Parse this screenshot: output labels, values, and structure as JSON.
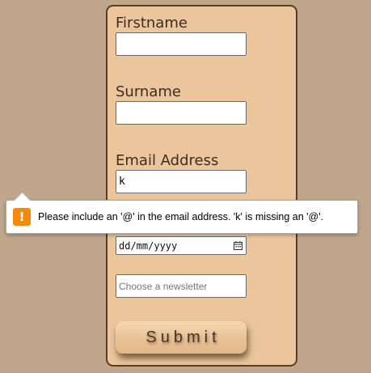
{
  "form": {
    "firstname_label": "Firstname",
    "firstname_value": "",
    "surname_label": "Surname",
    "surname_value": "",
    "email_label": "Email Address",
    "email_value": "k",
    "date_value": "dd/mm/yyyy",
    "newsletter_placeholder": "Choose a newsletter",
    "submit_label": "Submit"
  },
  "validation_tooltip": {
    "icon": "warning-icon",
    "message": "Please include an '@' in the email address. 'k' is missing an '@'.",
    "icon_color": "#f48a0c"
  },
  "colors": {
    "page_background": "#c0a78c",
    "card_background": "#ebc59c",
    "card_border": "#5a3d22"
  }
}
